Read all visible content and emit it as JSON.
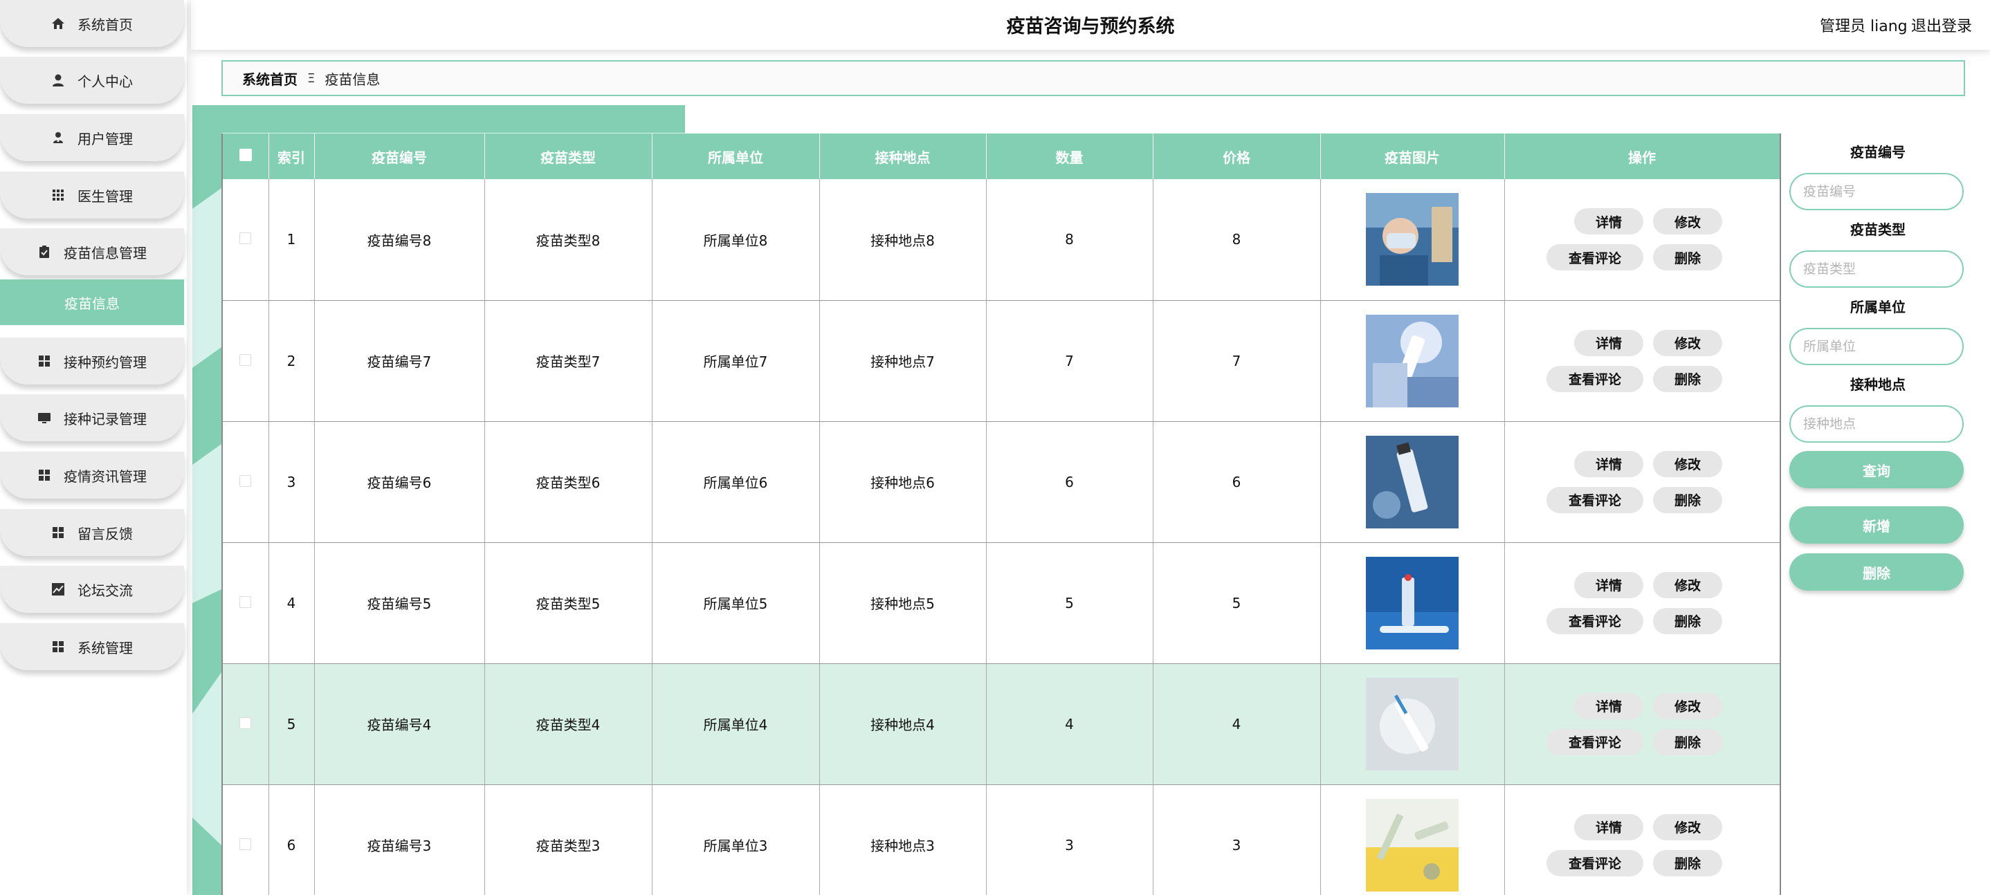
{
  "header": {
    "title": "疫苗咨询与预约系统",
    "user_label": "管理员 liang",
    "logout_label": "退出登录"
  },
  "sidebar": {
    "items": [
      {
        "label": "系统首页",
        "icon": "home-icon"
      },
      {
        "label": "个人中心",
        "icon": "user-icon"
      },
      {
        "label": "用户管理",
        "icon": "user-manage-icon"
      },
      {
        "label": "医生管理",
        "icon": "grid-icon"
      },
      {
        "label": "疫苗信息管理",
        "icon": "clipboard-icon"
      },
      {
        "label": "接种预约管理",
        "icon": "apps-icon"
      },
      {
        "label": "接种记录管理",
        "icon": "monitor-icon"
      },
      {
        "label": "疫情资讯管理",
        "icon": "apps-icon"
      },
      {
        "label": "留言反馈",
        "icon": "apps-icon"
      },
      {
        "label": "论坛交流",
        "icon": "chart-icon"
      },
      {
        "label": "系统管理",
        "icon": "apps-icon"
      }
    ],
    "active_sub_label": "疫苗信息"
  },
  "breadcrumb": {
    "home": "系统首页",
    "separator": "Ξ",
    "current": "疫苗信息"
  },
  "table": {
    "columns": [
      "索引",
      "疫苗编号",
      "疫苗类型",
      "所属单位",
      "接种地点",
      "数量",
      "价格",
      "疫苗图片",
      "操作"
    ],
    "rows": [
      {
        "index": "1",
        "code": "疫苗编号8",
        "type": "疫苗类型8",
        "unit": "所属单位8",
        "place": "接种地点8",
        "qty": "8",
        "price": "8"
      },
      {
        "index": "2",
        "code": "疫苗编号7",
        "type": "疫苗类型7",
        "unit": "所属单位7",
        "place": "接种地点7",
        "qty": "7",
        "price": "7"
      },
      {
        "index": "3",
        "code": "疫苗编号6",
        "type": "疫苗类型6",
        "unit": "所属单位6",
        "place": "接种地点6",
        "qty": "6",
        "price": "6"
      },
      {
        "index": "4",
        "code": "疫苗编号5",
        "type": "疫苗类型5",
        "unit": "所属单位5",
        "place": "接种地点5",
        "qty": "5",
        "price": "5"
      },
      {
        "index": "5",
        "code": "疫苗编号4",
        "type": "疫苗类型4",
        "unit": "所属单位4",
        "place": "接种地点4",
        "qty": "4",
        "price": "4"
      },
      {
        "index": "6",
        "code": "疫苗编号3",
        "type": "疫苗类型3",
        "unit": "所属单位3",
        "place": "接种地点3",
        "qty": "3",
        "price": "3"
      }
    ],
    "actions": {
      "detail": "详情",
      "edit": "修改",
      "comments": "查看评论",
      "delete": "删除"
    }
  },
  "search": {
    "code_label": "疫苗编号",
    "code_placeholder": "疫苗编号",
    "type_label": "疫苗类型",
    "type_placeholder": "疫苗类型",
    "unit_label": "所属单位",
    "unit_placeholder": "所属单位",
    "place_label": "接种地点",
    "place_placeholder": "接种地点",
    "query_label": "查询",
    "add_label": "新增",
    "delete_label": "删除"
  },
  "colors": {
    "accent": "#82cfb4",
    "row_highlight": "#d9f0e7",
    "button_gray": "#e6e6e6"
  }
}
